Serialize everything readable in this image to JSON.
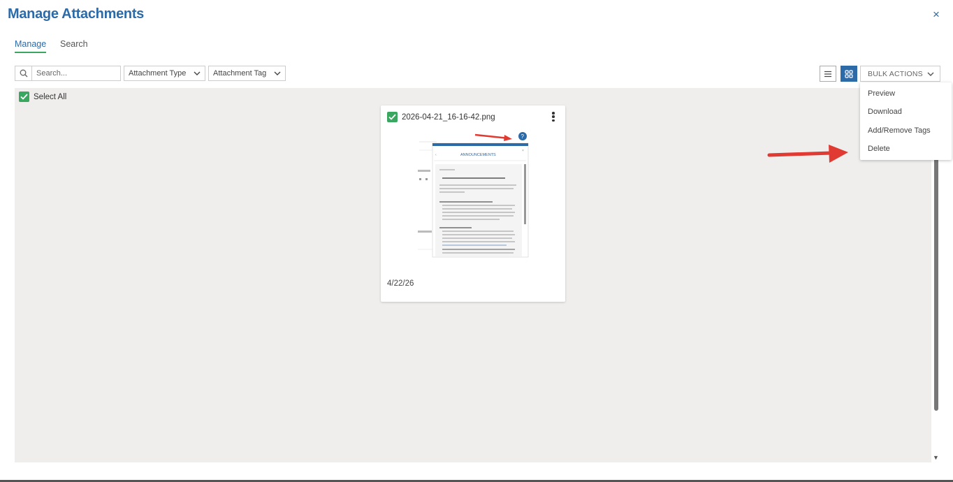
{
  "header": {
    "title": "Manage Attachments",
    "close_symbol": "×"
  },
  "tabs": [
    {
      "label": "Manage",
      "active": true
    },
    {
      "label": "Search",
      "active": false
    }
  ],
  "toolbar": {
    "search_placeholder": "Search...",
    "attachment_type_label": "Attachment Type",
    "attachment_tag_label": "Attachment Tag",
    "bulk_actions_label": "BULK ACTIONS",
    "active_view": "grid"
  },
  "select_all": {
    "label": "Select All",
    "checked": true
  },
  "attachments": [
    {
      "filename": "2026-04-21_16-16-42.png",
      "date": "4/22/26",
      "checked": true
    }
  ],
  "bulk_menu": {
    "items": [
      {
        "label": "Preview"
      },
      {
        "label": "Download"
      },
      {
        "label": "Add/Remove Tags"
      },
      {
        "label": "Delete"
      }
    ]
  },
  "colors": {
    "brand_blue": "#2c6aa8",
    "check_green": "#3aa760",
    "annotation_red": "#e03a32"
  }
}
